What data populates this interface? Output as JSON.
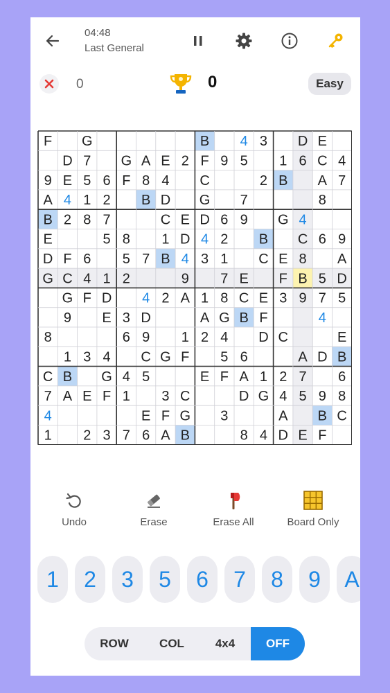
{
  "header": {
    "time": "04:48",
    "mode": "Last General",
    "back_icon": "arrow-left-icon",
    "pause_icon": "pause-icon",
    "settings_icon": "gear-icon",
    "info_icon": "info-icon",
    "key_icon": "key-icon"
  },
  "stats": {
    "mistakes": "0",
    "score": "0",
    "difficulty": "Easy"
  },
  "board": {
    "rows": [
      "F.G..........B.43..DE.",
      "",
      "",
      "",
      "",
      "",
      "",
      "",
      "",
      "",
      "",
      "",
      "",
      "",
      "",
      ""
    ],
    "grid": [
      [
        "F",
        "",
        "G",
        "",
        "",
        "",
        "",
        "",
        "B",
        "",
        "4",
        "3",
        "",
        "D",
        "E",
        ""
      ],
      [
        "",
        "D",
        "7",
        "",
        "G",
        "A",
        "E",
        "2",
        "F",
        "9",
        "5",
        "",
        "1",
        "6",
        "C",
        "4"
      ],
      [
        "9",
        "E",
        "5",
        "6",
        "F",
        "8",
        "4",
        "",
        "C",
        "",
        "",
        "2",
        "B",
        "",
        "A",
        "7"
      ],
      [
        "A",
        "4",
        "1",
        "2",
        "",
        "B",
        "D",
        "",
        "G",
        "",
        "7",
        "",
        "",
        "",
        "8",
        ""
      ],
      [
        "B",
        "2",
        "8",
        "7",
        "",
        "",
        "C",
        "E",
        "D",
        "6",
        "9",
        "",
        "G",
        "4",
        "",
        ""
      ],
      [
        "E",
        "",
        "",
        "5",
        "8",
        "",
        "1",
        "D",
        "4",
        "2",
        "",
        "B",
        "",
        "C",
        "6",
        "9"
      ],
      [
        "D",
        "F",
        "6",
        "",
        "5",
        "7",
        "B",
        "4",
        "3",
        "1",
        "",
        "C",
        "E",
        "8",
        "",
        "A"
      ],
      [
        "G",
        "C",
        "4",
        "1",
        "2",
        "",
        "",
        "9",
        "",
        "7",
        "E",
        "",
        "F",
        "B",
        "5",
        "D"
      ],
      [
        "",
        "G",
        "F",
        "D",
        "",
        "4",
        "2",
        "A",
        "1",
        "8",
        "C",
        "E",
        "3",
        "9",
        "7",
        "5"
      ],
      [
        "",
        "9",
        "",
        "E",
        "3",
        "D",
        "",
        "",
        "A",
        "G",
        "B",
        "F",
        "",
        "",
        "4",
        ""
      ],
      [
        "8",
        "",
        "",
        "",
        "6",
        "9",
        "",
        "1",
        "2",
        "4",
        "",
        "D",
        "C",
        "",
        "",
        "E"
      ],
      [
        "",
        "1",
        "3",
        "4",
        "",
        "C",
        "G",
        "F",
        "",
        "5",
        "6",
        "",
        "",
        "A",
        "D",
        "B"
      ],
      [
        "C",
        "B",
        "",
        "G",
        "4",
        "5",
        "",
        "",
        "E",
        "F",
        "A",
        "1",
        "2",
        "7",
        "",
        "6"
      ],
      [
        "7",
        "A",
        "E",
        "F",
        "1",
        "",
        "3",
        "C",
        "",
        "",
        "D",
        "G",
        "4",
        "5",
        "9",
        "8"
      ],
      [
        "4",
        "",
        "",
        "",
        "",
        "E",
        "F",
        "G",
        "",
        "3",
        "",
        "",
        "A",
        "",
        "B",
        "C"
      ],
      [
        "1",
        "",
        "2",
        "3",
        "7",
        "6",
        "A",
        "B",
        "",
        "",
        "8",
        "4",
        "D",
        "E",
        "F",
        ""
      ]
    ],
    "user_entries": [
      [
        0,
        10
      ],
      [
        3,
        1
      ],
      [
        4,
        13
      ],
      [
        5,
        8
      ],
      [
        6,
        7
      ],
      [
        8,
        5
      ],
      [
        9,
        14
      ],
      [
        14,
        0
      ]
    ],
    "highlight_b": [
      [
        0,
        8
      ],
      [
        2,
        12
      ],
      [
        3,
        5
      ],
      [
        4,
        0
      ],
      [
        5,
        11
      ],
      [
        6,
        6
      ],
      [
        9,
        10
      ],
      [
        11,
        15
      ],
      [
        12,
        1
      ],
      [
        14,
        14
      ],
      [
        15,
        7
      ]
    ],
    "selected": [
      7,
      13
    ],
    "colors": {
      "given": "#222222",
      "user": "#1e88e5",
      "highlight": "#bcd7f5",
      "selected": "#fdf3b0",
      "shade": "#eeeef2"
    }
  },
  "tools": {
    "undo": "Undo",
    "erase": "Erase",
    "erase_all": "Erase All",
    "board_only": "Board Only"
  },
  "keypad": [
    "1",
    "2",
    "3",
    "5",
    "6",
    "7",
    "8",
    "9",
    "A"
  ],
  "segment": {
    "options": [
      "ROW",
      "COL",
      "4x4",
      "OFF"
    ],
    "active": "OFF"
  }
}
